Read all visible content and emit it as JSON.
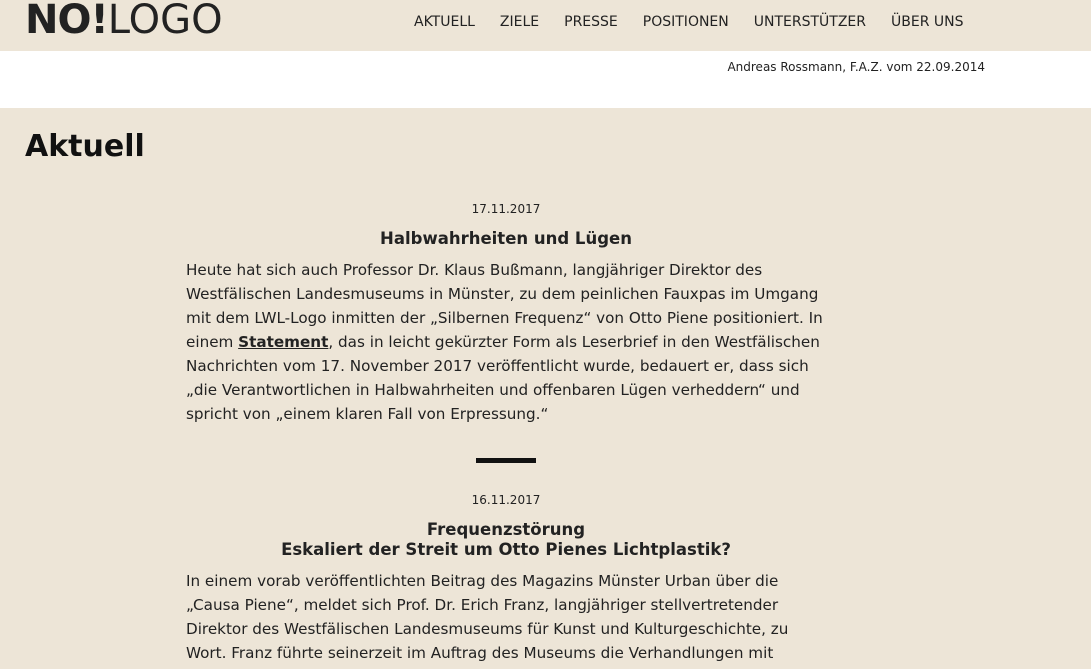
{
  "logo": {
    "no": "NO",
    "excl": "!",
    "rest": "LOGO"
  },
  "nav": [
    {
      "label": "AKTUELL"
    },
    {
      "label": "ZIELE"
    },
    {
      "label": "PRESSE"
    },
    {
      "label": "POSITIONEN"
    },
    {
      "label": "UNTERSTÜTZER"
    },
    {
      "label": "ÜBER UNS"
    }
  ],
  "quote": {
    "source": "Andreas Rossmann, F.A.Z. vom 22.09.2014"
  },
  "page": {
    "title": "Aktuell"
  },
  "articles": [
    {
      "date": "17.11.2017",
      "headline_line1": "Halbwahrheiten und Lügen",
      "body_before": "Heute hat sich auch Professor Dr. Klaus Bußmann, langjähriger Direktor des Westfälischen Landesmuseums in Münster, zu dem peinlichen Fauxpas im Umgang mit dem LWL-Logo inmitten der „Silbernen Frequenz“ von Otto Piene positioniert. In einem ",
      "link": "Statement",
      "body_after": ", das in leicht gekürzter Form als Leserbrief in den Westfälischen Nachrichten vom 17. November 2017 veröffentlicht wurde, bedauert er, dass sich „die Verantwortlichen in Halbwahrheiten und offenbaren Lügen verheddern“ und spricht von „einem klaren Fall von Erpressung.“"
    },
    {
      "date": "16.11.2017",
      "headline_line1": "Frequenzstörung",
      "headline_line2": "Eskaliert der Streit um Otto Pienes Lichtplastik?",
      "body": "In einem vorab veröffentlichten Beitrag des Magazins Münster Urban über die „Causa Piene“, meldet sich Prof. Dr. Erich Franz, langjähriger stellvertretender Direktor des Westfälischen Landesmuseums für Kunst und Kulturgeschichte, zu Wort. Franz führte seinerzeit im Auftrag des Museums die Verhandlungen mit"
    }
  ]
}
